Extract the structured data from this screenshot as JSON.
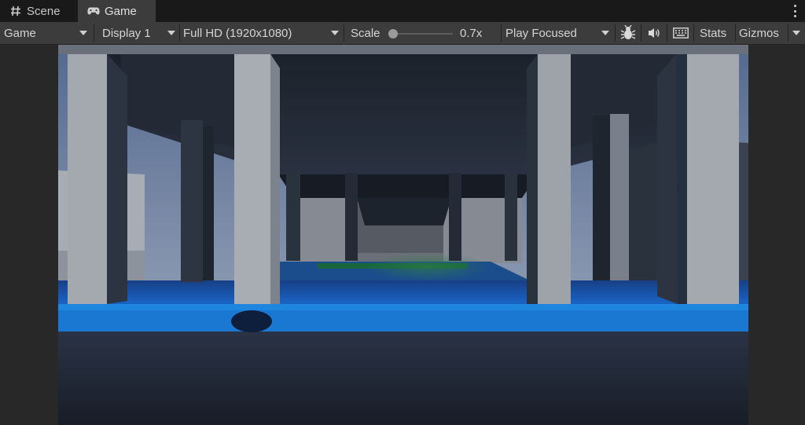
{
  "tabs": {
    "scene_label": "Scene",
    "game_label": "Game"
  },
  "toolbar": {
    "display_mode": "Game",
    "display": "Display 1",
    "resolution": "Full HD (1920x1080)",
    "scale_label": "Scale",
    "scale_value": "0.7x",
    "play_mode": "Play Focused",
    "stats_label": "Stats",
    "gizmos_label": "Gizmos"
  },
  "icons": {
    "scene": "hash-icon",
    "game": "gamepad-icon",
    "debug": "bug-icon",
    "audio": "speaker-icon",
    "keyboard": "keyboard-icon",
    "menu": "kebab-icon"
  },
  "colors": {
    "sky": "#6f86a8",
    "floor_blue": "#1e7fd8",
    "pillar": "#9ea2a9",
    "ceiling": "#1f2733",
    "ground": "#1c2330"
  }
}
